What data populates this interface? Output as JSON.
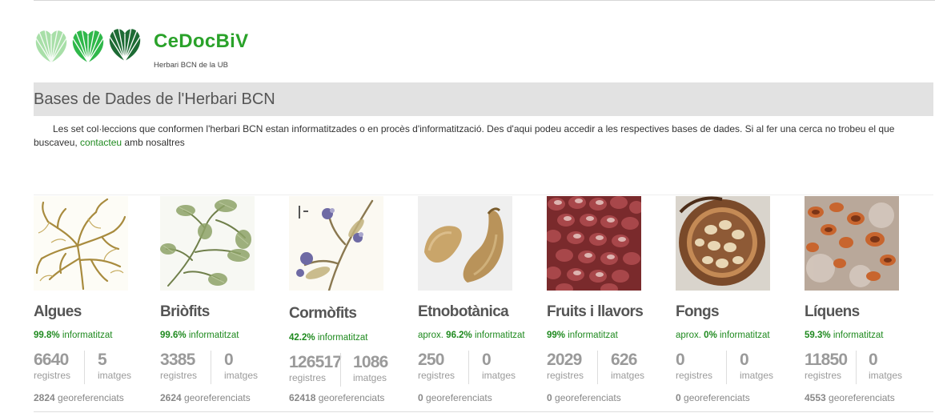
{
  "header": {
    "brand": "CeDocBiV",
    "subtitle": "Herbari BCN de la UB"
  },
  "section": {
    "title": "Bases de Dades de l'Herbari BCN"
  },
  "intro": {
    "text_before": "Les set col·leccions que conformen l'herbari BCN estan informatitzades o en procès d'informatització. Des d'aqui podeu accedir a les respectives bases de dades. Si al fer una cerca no trobeu el que buscaveu, ",
    "link": "contacteu",
    "text_after": " amb nosaltres"
  },
  "labels": {
    "informatitzat": "informatitzat",
    "registres": "registres",
    "imatges": "imatges",
    "georeferenciats": "georeferenciats"
  },
  "collections": [
    {
      "name": "Algues",
      "prefix": "",
      "percent": "99.8%",
      "registres": "6640",
      "imatges": "5",
      "geo": "2824"
    },
    {
      "name": "Briòfits",
      "prefix": "",
      "percent": "99.6%",
      "registres": "3385",
      "imatges": "0",
      "geo": "2624"
    },
    {
      "name": "Cormòfits",
      "prefix": "",
      "percent": "42.2%",
      "registres": "126517",
      "imatges": "1086",
      "geo": "62418"
    },
    {
      "name": "Etnobotànica",
      "prefix": "aprox. ",
      "percent": "96.2%",
      "registres": "250",
      "imatges": "0",
      "geo": "0"
    },
    {
      "name": "Fruits i llavors",
      "prefix": "",
      "percent": "99%",
      "registres": "2029",
      "imatges": "626",
      "geo": "0"
    },
    {
      "name": "Fongs",
      "prefix": "aprox. ",
      "percent": "0%",
      "registres": "0",
      "imatges": "0",
      "geo": "0"
    },
    {
      "name": "Líquens",
      "prefix": "",
      "percent": "59.3%",
      "registres": "11850",
      "imatges": "0",
      "geo": "4553"
    }
  ],
  "colors": {
    "brand_green": "#2aa22a",
    "link_green": "#1f8a1f",
    "section_bg": "#e2e2e2",
    "stat_gray": "#9a9a9a"
  },
  "icons": {
    "logo": "three-leaf-fan-logo"
  }
}
